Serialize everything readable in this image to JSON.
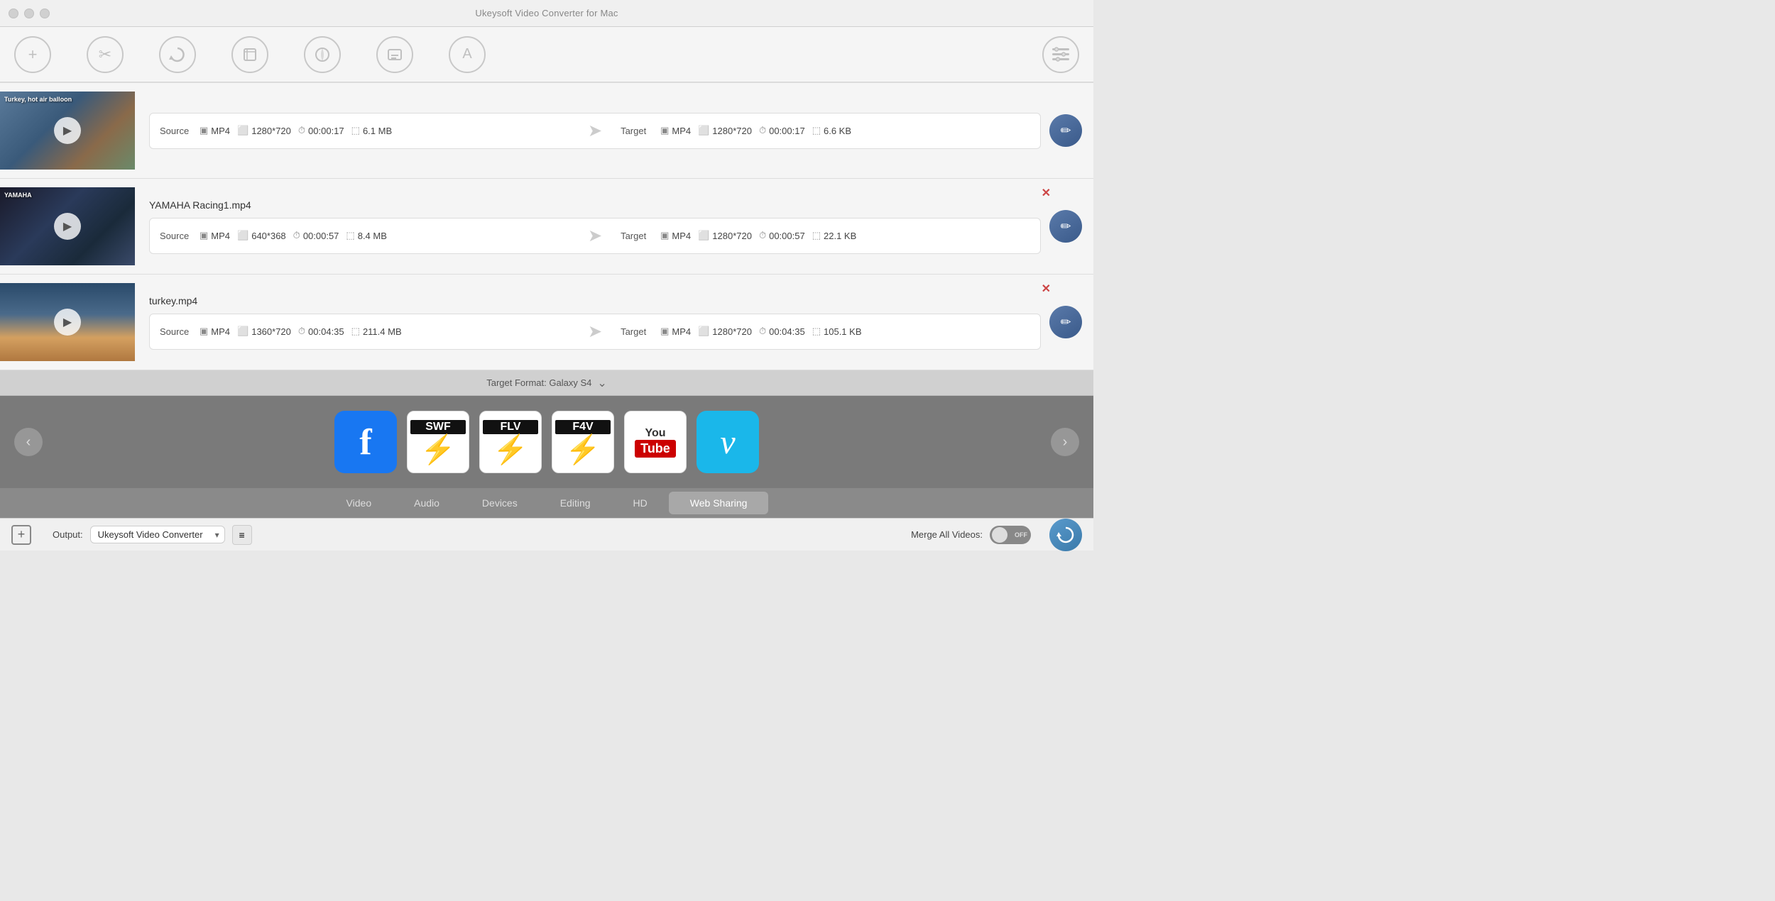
{
  "app": {
    "title": "Ukeysoft Video Converter for Mac"
  },
  "toolbar": {
    "icons": [
      {
        "name": "add-icon",
        "symbol": "+"
      },
      {
        "name": "convert-icon",
        "symbol": "✂"
      },
      {
        "name": "refresh-icon",
        "symbol": "↻"
      },
      {
        "name": "crop-icon",
        "symbol": "⊡"
      },
      {
        "name": "effect-icon",
        "symbol": "✦"
      },
      {
        "name": "subtitle-icon",
        "symbol": "T"
      },
      {
        "name": "watermark-icon",
        "symbol": "A"
      }
    ],
    "right_icon": {
      "name": "settings-icon",
      "symbol": "⚙"
    }
  },
  "videos": [
    {
      "id": "v1",
      "title": "Turkey, hot air balloon",
      "has_close": false,
      "thumbnail": "bg1",
      "thumbnail_label": "Turkey, hot air balloon",
      "source": {
        "format": "MP4",
        "resolution": "1280*720",
        "duration": "00:00:17",
        "size": "6.1 MB"
      },
      "target": {
        "format": "MP4",
        "resolution": "1280*720",
        "duration": "00:00:17",
        "size": "6.6 KB"
      }
    },
    {
      "id": "v2",
      "title": "YAMAHA Racing1.mp4",
      "has_close": true,
      "thumbnail": "bg2",
      "thumbnail_label": "YAMAHA",
      "source": {
        "format": "MP4",
        "resolution": "640*368",
        "duration": "00:00:57",
        "size": "8.4 MB"
      },
      "target": {
        "format": "MP4",
        "resolution": "1280*720",
        "duration": "00:00:57",
        "size": "22.1 KB"
      }
    },
    {
      "id": "v3",
      "title": "turkey.mp4",
      "has_close": true,
      "thumbnail": "bg3",
      "thumbnail_label": "",
      "source": {
        "format": "MP4",
        "resolution": "1360*720",
        "duration": "00:04:35",
        "size": "211.4 MB"
      },
      "target": {
        "format": "MP4",
        "resolution": "1280*720",
        "duration": "00:04:35",
        "size": "105.1 KB"
      }
    }
  ],
  "format_bar": {
    "label": "Target Format: Galaxy S4",
    "chevron": "⌄"
  },
  "format_icons": [
    {
      "id": "facebook",
      "label": "Facebook"
    },
    {
      "id": "swf",
      "label": "SWF"
    },
    {
      "id": "flv",
      "label": "FLV"
    },
    {
      "id": "f4v",
      "label": "F4V"
    },
    {
      "id": "youtube",
      "label": "YouTube"
    },
    {
      "id": "vimeo",
      "label": "Vimeo"
    }
  ],
  "tabs": [
    {
      "id": "video",
      "label": "Video",
      "active": false
    },
    {
      "id": "audio",
      "label": "Audio",
      "active": false
    },
    {
      "id": "devices",
      "label": "Devices",
      "active": false
    },
    {
      "id": "editing",
      "label": "Editing",
      "active": false
    },
    {
      "id": "hd",
      "label": "HD",
      "active": false
    },
    {
      "id": "web-sharing",
      "label": "Web Sharing",
      "active": true
    }
  ],
  "bottom": {
    "add_label": "+",
    "output_label": "Output:",
    "output_value": "Ukeysoft Video Converter",
    "merge_label": "Merge All Videos:",
    "toggle_state": "OFF",
    "convert_icon": "↻"
  }
}
